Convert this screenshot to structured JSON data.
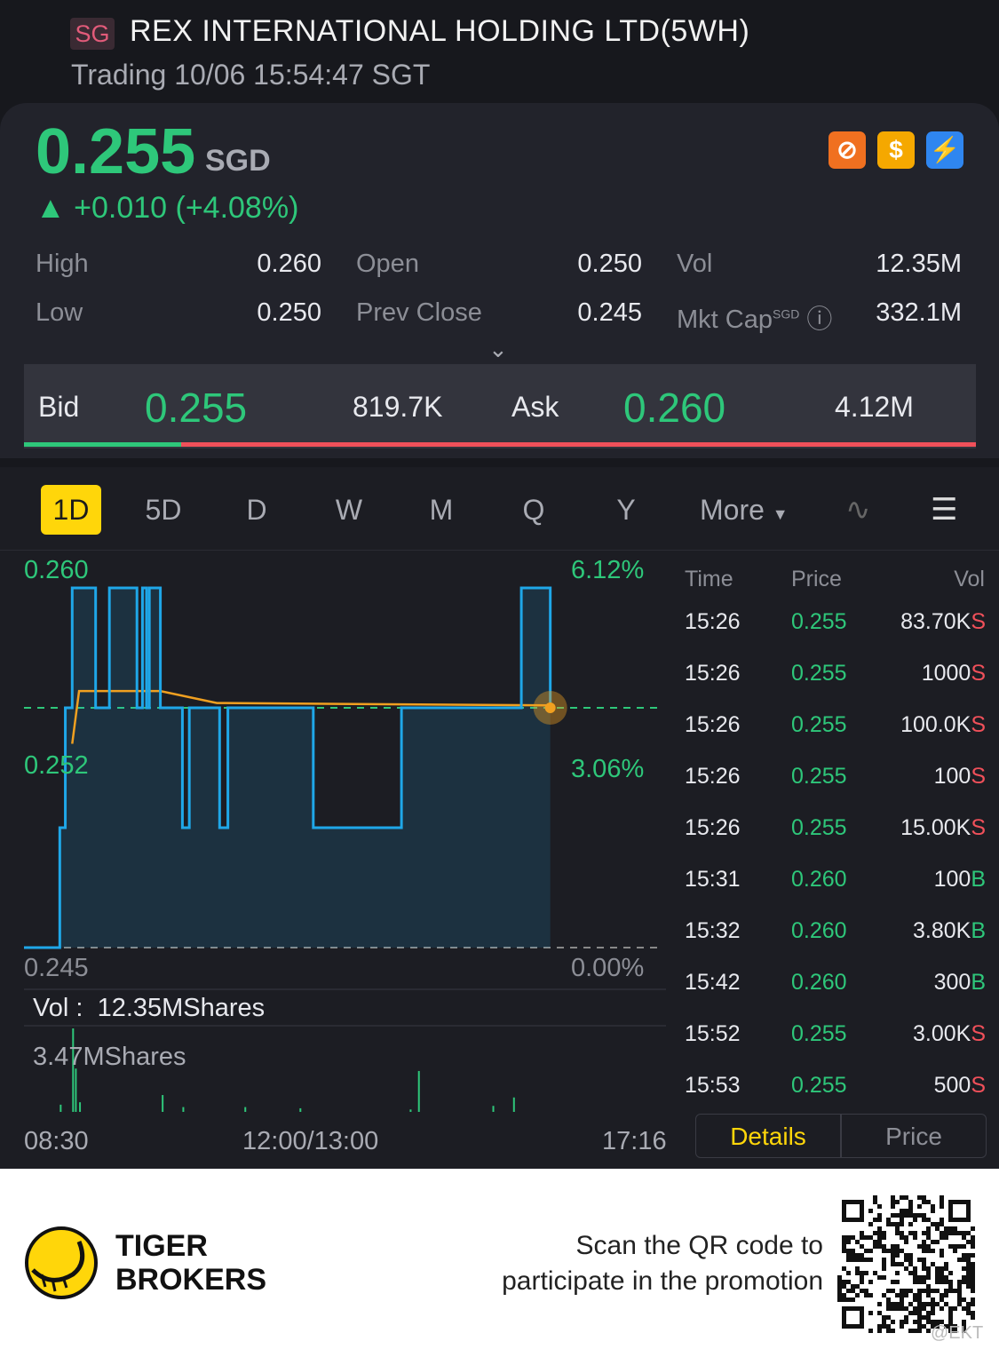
{
  "header": {
    "market": "SG",
    "title": "REX INTERNATIONAL HOLDING LTD(5WH)",
    "status": "Trading 10/06 15:54:47 SGT"
  },
  "quote": {
    "price": "0.255",
    "currency": "SGD",
    "change": "+0.010 (+4.08%)",
    "icons": [
      "no-short-icon",
      "dividend-icon",
      "flash-icon"
    ],
    "stats": [
      {
        "label": "High",
        "value": "0.260"
      },
      {
        "label": "Open",
        "value": "0.250"
      },
      {
        "label": "Vol",
        "value": "12.35M"
      },
      {
        "label": "Low",
        "value": "0.250"
      },
      {
        "label": "Prev Close",
        "value": "0.245"
      },
      {
        "label": "Mkt Cap",
        "value": "332.1M",
        "sup": "SGD"
      }
    ]
  },
  "bidask": {
    "bid_label": "Bid",
    "bid": "0.255",
    "bid_size": "819.7K",
    "ask_label": "Ask",
    "ask": "0.260",
    "ask_size": "4.12M",
    "bid_ratio": 0.165
  },
  "tabs": [
    "1D",
    "5D",
    "D",
    "W",
    "M",
    "Q",
    "Y",
    "More"
  ],
  "colors": {
    "up": "#2ec77a",
    "down": "#f0505a",
    "line": "#1fa7e8",
    "avg": "#f0a020",
    "accent": "#ffd60a"
  },
  "chart_data": {
    "type": "line",
    "ylim": [
      0.245,
      0.26
    ],
    "yticks": [
      "0.260",
      "0.252",
      "0.245"
    ],
    "pct_ticks": [
      "6.12%",
      "3.06%",
      "0.00%"
    ],
    "prev_close": 0.255,
    "xticks": [
      "08:30",
      "12:00/13:00",
      "17:16"
    ],
    "total_minutes": 466,
    "price": [
      [
        0,
        0.245
      ],
      [
        26,
        0.245
      ],
      [
        26,
        0.25
      ],
      [
        30,
        0.25
      ],
      [
        30,
        0.255
      ],
      [
        35,
        0.255
      ],
      [
        35,
        0.26
      ],
      [
        52,
        0.26
      ],
      [
        52,
        0.255
      ],
      [
        62,
        0.255
      ],
      [
        62,
        0.26
      ],
      [
        82,
        0.26
      ],
      [
        82,
        0.255
      ],
      [
        86,
        0.255
      ],
      [
        86,
        0.26
      ],
      [
        89,
        0.26
      ],
      [
        89,
        0.255
      ],
      [
        91,
        0.255
      ],
      [
        91,
        0.26
      ],
      [
        99,
        0.26
      ],
      [
        99,
        0.255
      ],
      [
        115,
        0.255
      ],
      [
        115,
        0.25
      ],
      [
        120,
        0.25
      ],
      [
        120,
        0.255
      ],
      [
        142,
        0.255
      ],
      [
        142,
        0.25
      ],
      [
        148,
        0.25
      ],
      [
        148,
        0.255
      ],
      [
        210,
        0.255
      ],
      [
        210,
        0.25
      ],
      [
        274,
        0.25
      ],
      [
        274,
        0.255
      ],
      [
        361,
        0.255
      ],
      [
        361,
        0.26
      ],
      [
        382,
        0.26
      ],
      [
        382,
        0.255
      ]
    ],
    "avg": [
      [
        35,
        0.2535
      ],
      [
        40,
        0.2557
      ],
      [
        99,
        0.2557
      ],
      [
        140,
        0.2552
      ],
      [
        382,
        0.2551
      ]
    ],
    "vol_label": "Vol :",
    "vol_total": "12.35MShares",
    "vol_max": "3.47MShares",
    "volumes": [
      [
        26,
        0.3
      ],
      [
        35,
        3.47
      ],
      [
        37,
        1.8
      ],
      [
        40,
        0.4
      ],
      [
        100,
        0.7
      ],
      [
        115,
        0.2
      ],
      [
        160,
        0.2
      ],
      [
        200,
        0.15
      ],
      [
        280,
        0.1
      ],
      [
        286,
        1.7
      ],
      [
        340,
        0.25
      ],
      [
        355,
        0.6
      ]
    ]
  },
  "trades": {
    "headers": [
      "Time",
      "Price",
      "Vol"
    ],
    "rows": [
      [
        "15:26",
        "0.255",
        "83.70K",
        "S"
      ],
      [
        "15:26",
        "0.255",
        "1000",
        "S"
      ],
      [
        "15:26",
        "0.255",
        "100.0K",
        "S"
      ],
      [
        "15:26",
        "0.255",
        "100",
        "S"
      ],
      [
        "15:26",
        "0.255",
        "15.00K",
        "S"
      ],
      [
        "15:31",
        "0.260",
        "100",
        "B"
      ],
      [
        "15:32",
        "0.260",
        "3.80K",
        "B"
      ],
      [
        "15:42",
        "0.260",
        "300",
        "B"
      ],
      [
        "15:52",
        "0.255",
        "3.00K",
        "S"
      ],
      [
        "15:53",
        "0.255",
        "500",
        "S"
      ]
    ],
    "buttons": [
      "Details",
      "Price"
    ]
  },
  "footer": {
    "brand1": "TIGER",
    "brand2": "BROKERS",
    "promo1": "Scan the QR code to",
    "promo2": "participate in the promotion",
    "watermark": "@EKT"
  }
}
